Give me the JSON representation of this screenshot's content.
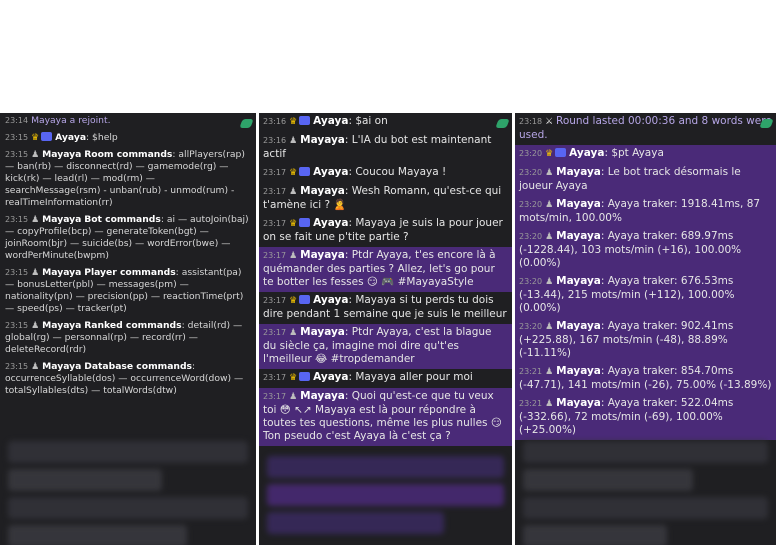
{
  "col1": {
    "messages": [
      {
        "time": "23:14",
        "text": "Mayaya a rejoint.",
        "system": true
      },
      {
        "time": "23:15",
        "user": "Ayaya",
        "content": ": $help",
        "crown": true,
        "badge": true
      },
      {
        "time": "23:15",
        "user": "Mayaya",
        "bold": "Room commands",
        "content": ": allPlayers(rap) — ban(rb) — disconnect(rd) — gamemode(rg) — kick(rk) — lead(rl) — mod(rm) — searchMessage(rsm) - unban(rub) - unmod(rum) - realTimeInformation(rr)"
      },
      {
        "time": "23:15",
        "user": "Mayaya",
        "bold": "Bot commands",
        "content": ": ai — autoJoin(baj) — copyProfile(bcp) — generateToken(bgt) — joinRoom(bjr) — suicide(bs) — wordError(bwe) — wordPerMinute(bwpm)"
      },
      {
        "time": "23:15",
        "user": "Mayaya",
        "bold": "Player commands",
        "content": ": assistant(pa) — bonusLetter(pbl) — messages(pm) — nationality(pn) — precision(pp) — reactionTime(prt) — speed(ps) — tracker(pt)"
      },
      {
        "time": "23:15",
        "user": "Mayaya",
        "bold": "Ranked commands",
        "content": ": detail(rd) — global(rg) — personnal(rp) — record(rr) — deleteRecord(rdr)"
      },
      {
        "time": "23:15",
        "user": "Mayaya",
        "bold": "Database commands",
        "content": ": occurrenceSyllable(dos) — occurrenceWord(dow) — totalSyllables(dts) — totalWords(dtw)"
      }
    ]
  },
  "col2": {
    "messages": [
      {
        "time": "23:16",
        "user": "Ayaya",
        "content": ": $ai on",
        "crown": true,
        "badge": true,
        "hl": false
      },
      {
        "time": "23:16",
        "user": "Mayaya",
        "content": ": L'IA du bot est maintenant actif",
        "hl": false
      },
      {
        "time": "23:17",
        "user": "Ayaya",
        "content": ": Coucou Mayaya !",
        "crown": true,
        "badge": true,
        "hl": false
      },
      {
        "time": "23:17",
        "user": "Mayaya",
        "content": ":  Wesh Romann, qu'est-ce qui t'amène ici ? 🙎",
        "hl": false
      },
      {
        "time": "23:17",
        "user": "Ayaya",
        "content": ": Mayaya je suis la pour jouer on se fait une p'tite partie ?",
        "crown": true,
        "badge": true,
        "hl": false
      },
      {
        "time": "23:17",
        "user": "Mayaya",
        "content": ": Ptdr Ayaya, t'es encore là à quémander des parties ? Allez, let's go pour te botter les fesses 😏 🎮 #MayayaStyle",
        "hl": true
      },
      {
        "time": "23:17",
        "user": "Ayaya",
        "content": ": Mayaya si tu perds tu dois dire pendant 1 semaine que je suis le meilleur",
        "crown": true,
        "badge": true,
        "hl": false
      },
      {
        "time": "23:17",
        "user": "Mayaya",
        "content": ": Ptdr Ayaya, c'est la blague du siècle ça, imagine moi dire qu't'es l'meilleur 😂 #tropdemander",
        "hl": true
      },
      {
        "time": "23:17",
        "user": "Ayaya",
        "content": ": Mayaya aller pour moi",
        "crown": true,
        "badge": true,
        "hl": false
      },
      {
        "time": "23:17",
        "user": "Mayaya",
        "content": ": Quoi qu'est-ce que tu veux toi 😳 ↖↗ Mayaya est là pour répondre à toutes tes questions, même les plus nulles 😏 Ton pseudo c'est Ayaya là c'est ça ?",
        "hl": true
      }
    ]
  },
  "col3": {
    "messages": [
      {
        "time": "23:18",
        "system": true,
        "content": "Round lasted 00:00:36 and 8 words were used.",
        "hl": false
      },
      {
        "time": "23:20",
        "user": "Ayaya",
        "content": ": $pt Ayaya",
        "crown": true,
        "badge": true,
        "hl": true
      },
      {
        "time": "23:20",
        "user": "Mayaya",
        "content": ": Le bot track désormais le joueur Ayaya",
        "hl": true
      },
      {
        "time": "23:20",
        "user": "Mayaya",
        "content": ": Ayaya traker: 1918.41ms, 87 mots/min, 100.00%",
        "hl": true
      },
      {
        "time": "23:20",
        "user": "Mayaya",
        "content": ": Ayaya traker: 689.97ms (-1228.44), 103 mots/min (+16), 100.00% (0.00%)",
        "hl": true
      },
      {
        "time": "23:20",
        "user": "Mayaya",
        "content": ": Ayaya traker: 676.53ms (-13.44), 215 mots/min (+112), 100.00% (0.00%)",
        "hl": true
      },
      {
        "time": "23:20",
        "user": "Mayaya",
        "content": ": Ayaya traker: 902.41ms (+225.88), 167 mots/min (-48), 88.89% (-11.11%)",
        "hl": true
      },
      {
        "time": "23:21",
        "user": "Mayaya",
        "content": ": Ayaya traker: 854.70ms (-47.71), 141 mots/min (-26), 75.00% (-13.89%)",
        "hl": true
      },
      {
        "time": "23:21",
        "user": "Mayaya",
        "content": ": Ayaya traker: 522.04ms (-332.66), 72 mots/min (-69), 100.00% (+25.00%)",
        "hl": true
      }
    ]
  }
}
